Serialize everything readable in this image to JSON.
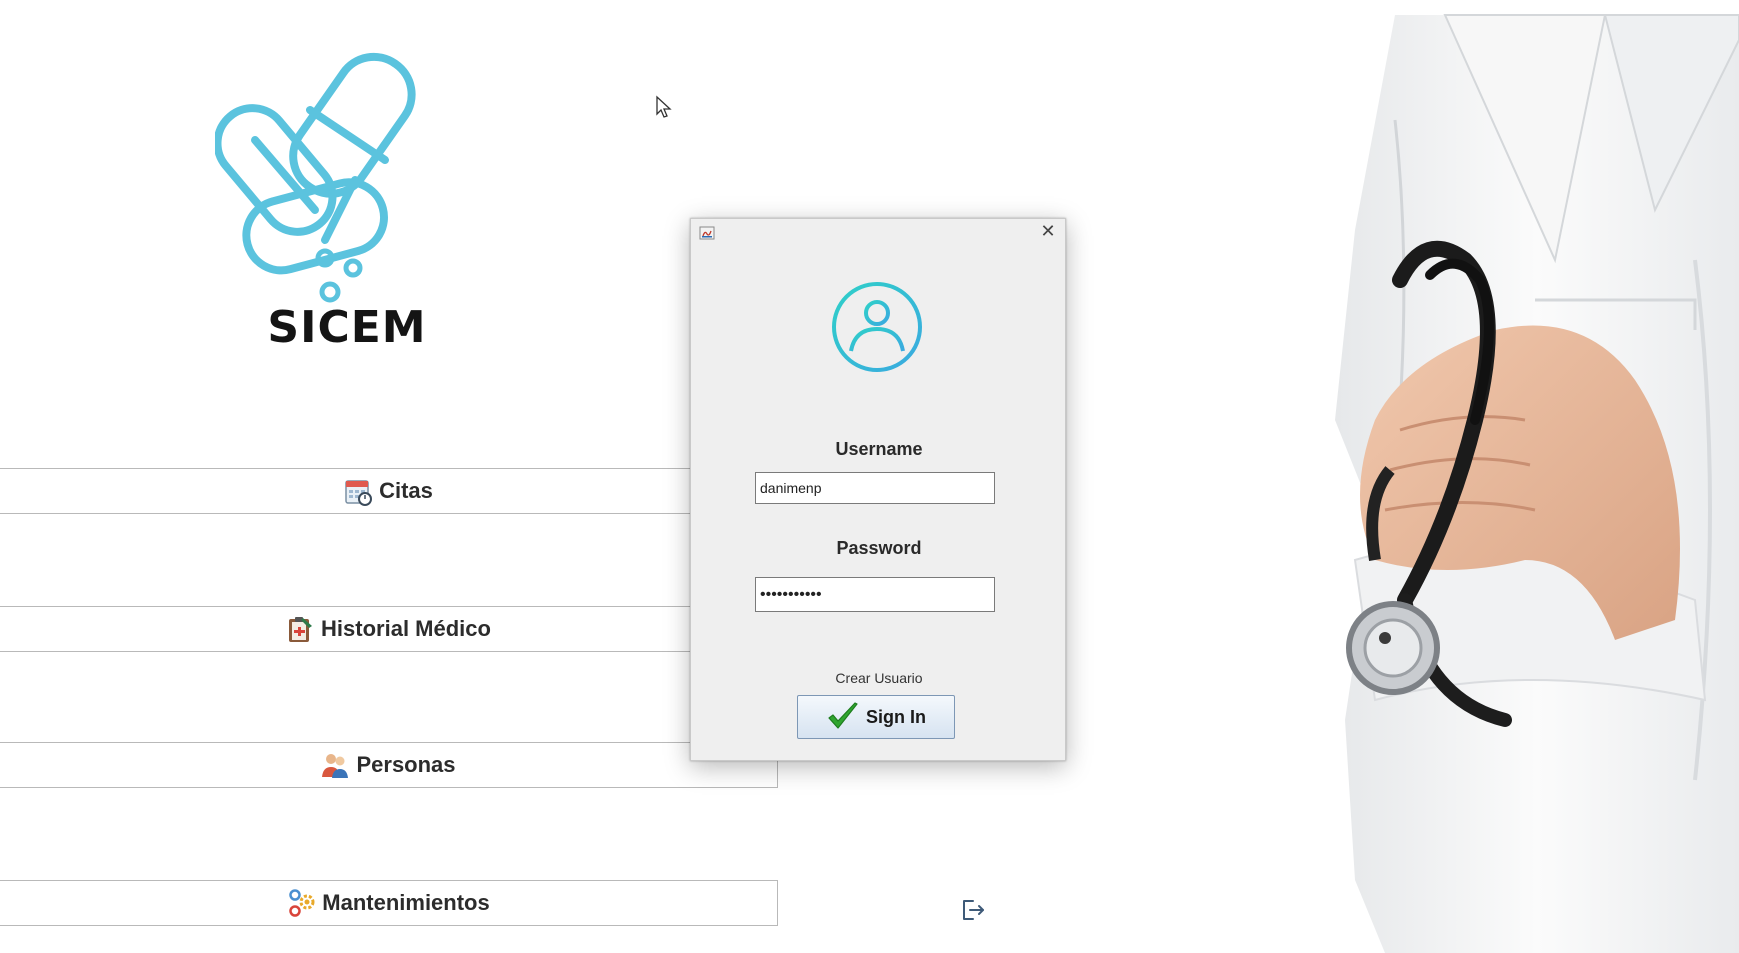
{
  "logo": {
    "title": "SICEM"
  },
  "menu": {
    "citas": "Citas",
    "historial": "Historial Médico",
    "personas": "Personas",
    "mantenimientos": "Mantenimientos"
  },
  "login": {
    "username_label": "Username",
    "username_value": "danimenp",
    "password_label": "Password",
    "password_value": "•••••••••••",
    "crear_usuario": "Crear Usuario",
    "signin_label": "Sign In",
    "close_glyph": "✕"
  },
  "colors": {
    "logo_blue": "#5bc3de",
    "avatar_cyan": "#3dc6d2",
    "signin_check": "#2fa52f"
  }
}
